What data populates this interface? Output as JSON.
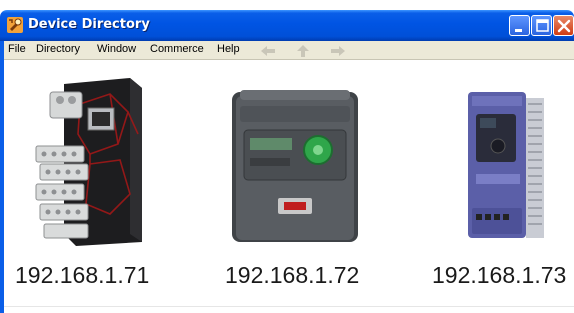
{
  "window": {
    "title": "Device Directory",
    "icon": "wrench-tool-icon",
    "controls": [
      "minimize",
      "maximize",
      "close"
    ]
  },
  "menu": {
    "items": [
      "File",
      "Directory",
      "Window",
      "Commerce",
      "Help"
    ],
    "nav_icons": [
      "back-arrow-icon",
      "up-arrow-icon",
      "forward-arrow-icon"
    ]
  },
  "devices": [
    {
      "ip": "192.168.1.71",
      "image": "din-rail-controller"
    },
    {
      "ip": "192.168.1.72",
      "image": "green-keypad-drive"
    },
    {
      "ip": "192.168.1.73",
      "image": "blue-compact-drive"
    }
  ],
  "colors": {
    "titlebar": "#0054e3",
    "menubar": "#ece9d8",
    "close_button": "#d03c13"
  }
}
